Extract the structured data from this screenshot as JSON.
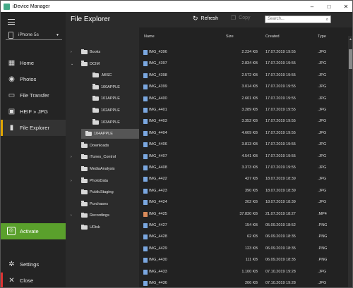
{
  "window": {
    "title": "iDevice Manager",
    "controls": [
      "–",
      "□",
      "✕"
    ]
  },
  "sidebar": {
    "menu_icon": "hamburger-icon",
    "device": "iPhone 5s",
    "items": [
      {
        "label": "Home",
        "icon": "home-icon"
      },
      {
        "label": "Photos",
        "icon": "camera-icon"
      },
      {
        "label": "File Transfer",
        "icon": "file-transfer-icon"
      },
      {
        "label": "HEIF » JPG",
        "icon": "image-convert-icon"
      },
      {
        "label": "File Explorer",
        "icon": "folder-icon"
      }
    ],
    "activate_label": "Activate",
    "settings_label": "Settings",
    "close_label": "Close",
    "active_color": "#e0a500",
    "activate_color": "#5aa02c"
  },
  "header": {
    "title": "File Explorer",
    "refresh_label": "Refresh",
    "copy_label": "Copy",
    "search_placeholder": "Search..."
  },
  "tree": [
    {
      "label": "Books",
      "expander": "›"
    },
    {
      "label": "DCIM",
      "expander": "⌄"
    },
    {
      "label": ".MISC",
      "expander": ""
    },
    {
      "label": "100APPLE",
      "expander": ""
    },
    {
      "label": "101APPLE",
      "expander": ""
    },
    {
      "label": "102APPLE",
      "expander": ""
    },
    {
      "label": "103APPLE",
      "expander": ""
    },
    {
      "label": "104APPLE",
      "expander": "",
      "selected": true
    },
    {
      "label": "Downloads",
      "expander": ""
    },
    {
      "label": "iTunes_Control",
      "expander": "›"
    },
    {
      "label": "MediaAnalysis",
      "expander": ""
    },
    {
      "label": "PhotoData",
      "expander": "›"
    },
    {
      "label": "PublicStaging",
      "expander": ""
    },
    {
      "label": "Purchases",
      "expander": ""
    },
    {
      "label": "Recordings",
      "expander": "›"
    },
    {
      "label": "UDisk",
      "expander": ""
    }
  ],
  "files": {
    "columns": [
      "Name",
      "Size",
      "Created",
      "Type"
    ],
    "rows": [
      [
        "IMG_4396",
        "2.234 KB",
        "17.07.2019 19:55",
        ".JPG"
      ],
      [
        "IMG_4397",
        "2.834 KB",
        "17.07.2019 19:55",
        ".JPG"
      ],
      [
        "IMG_4398",
        "2.572 KB",
        "17.07.2019 19:55",
        ".JPG"
      ],
      [
        "IMG_4399",
        "3.014 KB",
        "17.07.2019 19:55",
        ".JPG"
      ],
      [
        "IMG_4400",
        "2.601 KB",
        "17.07.2019 19:55",
        ".JPG"
      ],
      [
        "IMG_4401",
        "3.289 KB",
        "17.07.2019 19:55",
        ".JPG"
      ],
      [
        "IMG_4403",
        "3.352 KB",
        "17.07.2019 19:55",
        ".JPG"
      ],
      [
        "IMG_4404",
        "4.609 KB",
        "17.07.2019 19:55",
        ".JPG"
      ],
      [
        "IMG_4406",
        "3.813 KB",
        "17.07.2019 19:55",
        ".JPG"
      ],
      [
        "IMG_4407",
        "4.541 KB",
        "17.07.2019 19:55",
        ".JPG"
      ],
      [
        "IMG_4408",
        "3.373 KB",
        "17.07.2019 19:55",
        ".JPG"
      ],
      [
        "IMG_4422",
        "427 KB",
        "18.07.2019 18:39",
        ".JPG"
      ],
      [
        "IMG_4423",
        "390 KB",
        "18.07.2019 18:39",
        ".JPG"
      ],
      [
        "IMG_4424",
        "202 KB",
        "18.07.2019 18:39",
        ".JPG"
      ],
      [
        "IMG_4425",
        "37.830 KB",
        "21.07.2019 18:27",
        ".MP4"
      ],
      [
        "IMG_4427",
        "154 KB",
        "05.09.2019 18:52",
        ".PNG"
      ],
      [
        "IMG_4428",
        "62 KB",
        "06.09.2019 18:35",
        ".PNG"
      ],
      [
        "IMG_4429",
        "123 KB",
        "06.09.2019 18:35",
        ".PNG"
      ],
      [
        "IMG_4430",
        "111 KB",
        "06.09.2019 18:35",
        ".PNG"
      ],
      [
        "IMG_4433",
        "1.100 KB",
        "07.10.2019 19:28",
        ".JPG"
      ],
      [
        "IMG_4436",
        "206 KB",
        "07.10.2019 19:28",
        ".JPG"
      ]
    ]
  }
}
